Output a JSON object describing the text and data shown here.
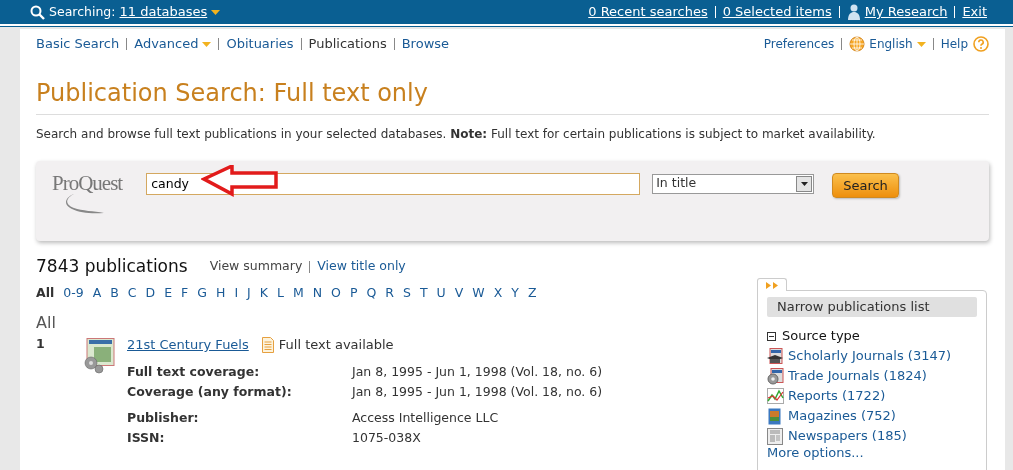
{
  "topbar": {
    "searching_label": "Searching:",
    "databases_link": "11 databases",
    "links": [
      {
        "label": "0 Recent searches",
        "kind": "plain"
      },
      {
        "label": "0 Selected items",
        "kind": "plain"
      },
      {
        "label": "My Research",
        "kind": "person"
      },
      {
        "label": "Exit",
        "kind": "plain"
      }
    ]
  },
  "nav": {
    "items": [
      {
        "label": "Basic Search",
        "selected": false,
        "dropdown": false
      },
      {
        "label": "Advanced",
        "selected": false,
        "dropdown": true
      },
      {
        "label": "Obituaries",
        "selected": false,
        "dropdown": false
      },
      {
        "label": "Publications",
        "selected": true,
        "dropdown": false
      },
      {
        "label": "Browse",
        "selected": false,
        "dropdown": false
      }
    ],
    "right": [
      {
        "label": "Preferences",
        "kind": "plain"
      },
      {
        "label": "English",
        "kind": "language"
      },
      {
        "label": "Help",
        "kind": "help"
      }
    ]
  },
  "title": "Publication Search: Full text only",
  "description": "Search and browse full text publications in your selected databases. **Note:** Full text for certain publications is subject to market availability.",
  "search": {
    "logo": "ProQuest",
    "value": "candy",
    "scope": "In title",
    "button": "Search"
  },
  "results": {
    "count": "7843 publications",
    "views": [
      {
        "label": "View summary",
        "selected": true
      },
      {
        "label": "View title only",
        "selected": false
      }
    ],
    "letters": [
      {
        "label": "All",
        "selected": true
      },
      {
        "label": "0-9",
        "selected": false
      },
      {
        "label": "A",
        "selected": false
      },
      {
        "label": "B",
        "selected": false
      },
      {
        "label": "C",
        "selected": false
      },
      {
        "label": "D",
        "selected": false
      },
      {
        "label": "E",
        "selected": false
      },
      {
        "label": "F",
        "selected": false
      },
      {
        "label": "G",
        "selected": false
      },
      {
        "label": "H",
        "selected": false
      },
      {
        "label": "I",
        "selected": false
      },
      {
        "label": "J",
        "selected": false
      },
      {
        "label": "K",
        "selected": false
      },
      {
        "label": "L",
        "selected": false
      },
      {
        "label": "M",
        "selected": false
      },
      {
        "label": "N",
        "selected": false
      },
      {
        "label": "O",
        "selected": false
      },
      {
        "label": "P",
        "selected": false
      },
      {
        "label": "Q",
        "selected": false
      },
      {
        "label": "R",
        "selected": false
      },
      {
        "label": "S",
        "selected": false
      },
      {
        "label": "T",
        "selected": false
      },
      {
        "label": "U",
        "selected": false
      },
      {
        "label": "V",
        "selected": false
      },
      {
        "label": "W",
        "selected": false
      },
      {
        "label": "X",
        "selected": false
      },
      {
        "label": "Y",
        "selected": false
      },
      {
        "label": "Z",
        "selected": false
      }
    ],
    "section": "All",
    "items": [
      {
        "number": "1",
        "title": "21st Century Fuels",
        "full_text": "Full text available",
        "field_groups": [
          [
            {
              "label": "Full text coverage:",
              "value": "Jan 8, 1995 - Jun 1, 1998 (Vol. 18, no. 6)"
            },
            {
              "label": "Coverage (any format):",
              "value": "Jan 8, 1995 - Jun 1, 1998 (Vol. 18, no. 6)"
            }
          ],
          [
            {
              "label": "Publisher:",
              "value": "Access Intelligence LLC"
            },
            {
              "label": "ISSN:",
              "value": "1075-038X"
            }
          ]
        ]
      }
    ]
  },
  "sidebar": {
    "header": "Narrow publications list",
    "group": {
      "label": "Source type",
      "expanded": true
    },
    "items": [
      {
        "label": "Scholarly Journals (3147)",
        "kind": "scholarly"
      },
      {
        "label": "Trade Journals (1824)",
        "kind": "trade"
      },
      {
        "label": "Reports (1722)",
        "kind": "reports"
      },
      {
        "label": "Magazines (752)",
        "kind": "magazines"
      },
      {
        "label": "Newspapers (185)",
        "kind": "newspapers"
      }
    ],
    "more": "More options..."
  }
}
